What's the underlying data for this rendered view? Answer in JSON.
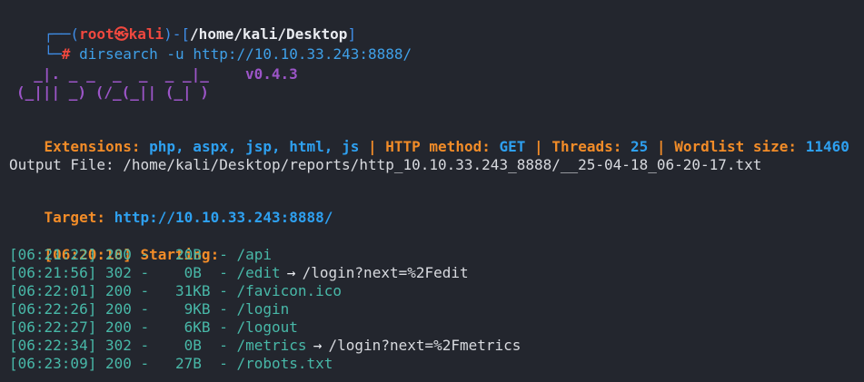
{
  "prompt": {
    "corner_top": "┌──(",
    "user": "root",
    "at_symbol": "㉿",
    "host": "kali",
    "dir_open": ")-[",
    "path": "/home/kali/Desktop",
    "dir_close": "]",
    "corner_bottom": "└─",
    "hash": "#",
    "command_name": "dirsearch",
    "command_args": "-u http://10.10.33.243:8888/"
  },
  "banner": {
    "logo_line1": "  _|. _ _  _  _  _ _|_",
    "logo_line2": "(_||| _) (/_(_|| (_| )",
    "version": "v0.4.3"
  },
  "config": {
    "ext_label": "Extensions:",
    "ext_value": "php, aspx, jsp, html, js",
    "sep": "|",
    "method_label": "HTTP method:",
    "method_value": "GET",
    "threads_label": "Threads:",
    "threads_value": "25",
    "wordlist_label": "Wordlist size:",
    "wordlist_value": "11460"
  },
  "output_file": "Output File: /home/kali/Desktop/reports/http_10.10.33.243_8888/__25-04-18_06-20-17.txt",
  "target": {
    "label": "Target:",
    "url": "http://10.10.33.243:8888/"
  },
  "start": {
    "time": "[06:20:18]",
    "label": "Starting:"
  },
  "results": [
    {
      "line": "[06:21:22] 200 -   20B  - /api",
      "redirect": ""
    },
    {
      "line": "[06:21:56] 302 -    0B  - /edit",
      "redirect": "/login?next=%2Fedit"
    },
    {
      "line": "[06:22:01] 200 -   31KB - /favicon.ico",
      "redirect": ""
    },
    {
      "line": "[06:22:26] 200 -    9KB - /login",
      "redirect": ""
    },
    {
      "line": "[06:22:27] 200 -    6KB - /logout",
      "redirect": ""
    },
    {
      "line": "[06:22:34] 302 -    0B  - /metrics",
      "redirect": "/login?next=%2Fmetrics"
    },
    {
      "line": "[06:23:09] 200 -   27B  - /robots.txt",
      "redirect": ""
    }
  ],
  "redirect_arrow": "→",
  "colors": {
    "background": "#23262e",
    "prompt_frame": "#3f8ee8",
    "root_user": "#f0483f",
    "label_orange": "#f28c28",
    "value_blue": "#2ea0f0",
    "result_cyan": "#48b8a8",
    "banner_purple": "#9c55c8"
  }
}
